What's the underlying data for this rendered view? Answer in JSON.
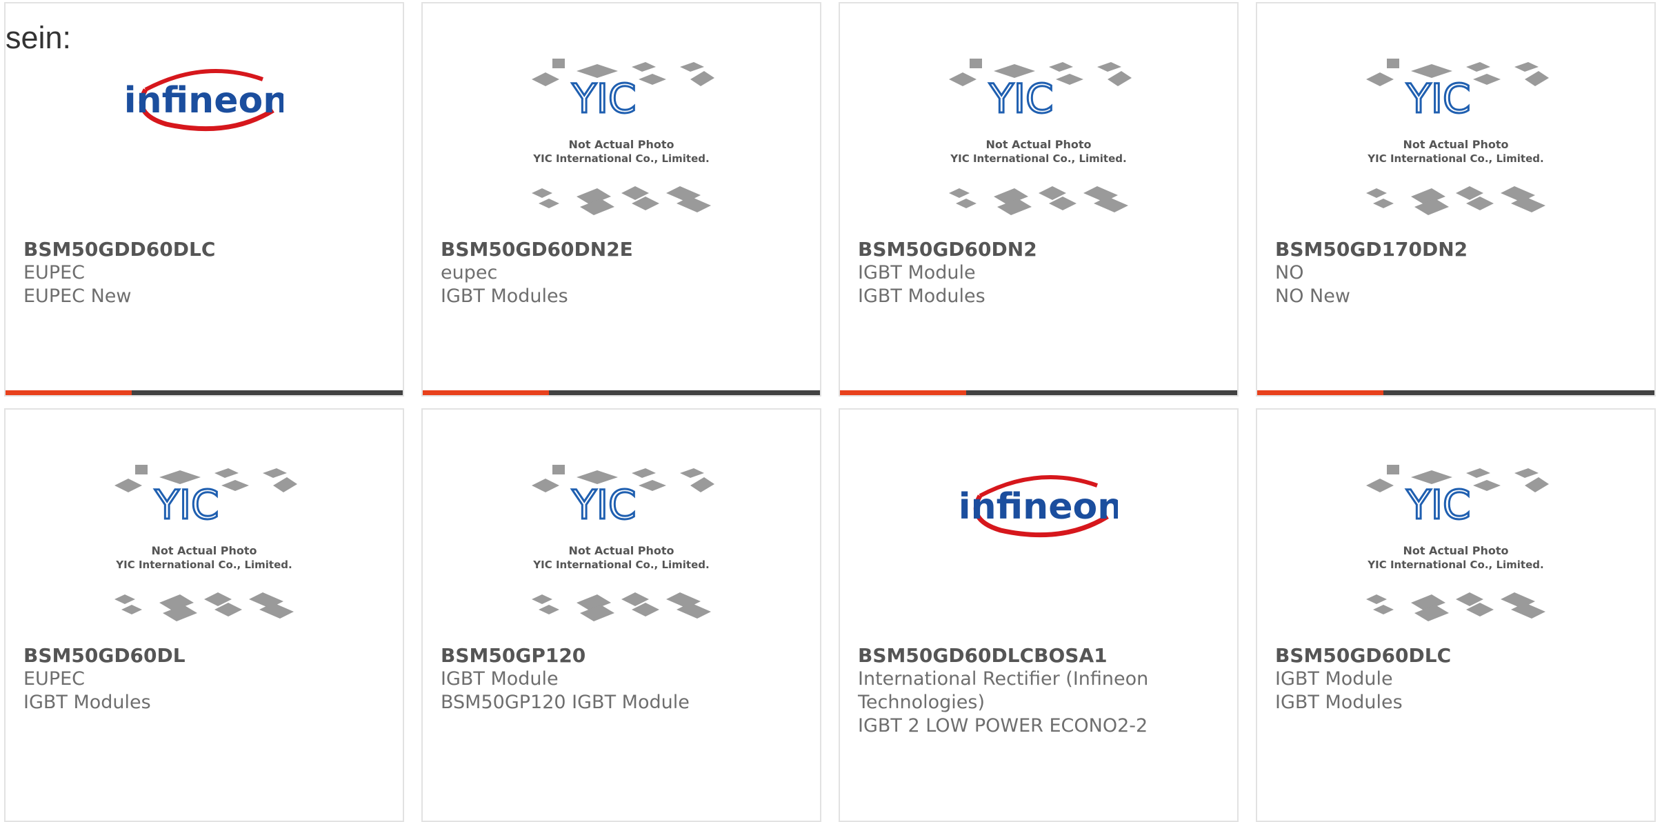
{
  "intro_text": "sein:",
  "colors": {
    "accent": "#e8411c",
    "bar": "#424242",
    "border": "#e2e2e2",
    "yic_blue": "#1f5fb0",
    "infineon_blue": "#1b4e9e",
    "infineon_red": "#d6171c"
  },
  "placeholder": {
    "line1": "Not Actual Photo",
    "line2": "YIC International Co., Limited.",
    "logo": "YIC"
  },
  "infineon_logo_text": "infineon",
  "products": [
    {
      "part": "BSM50GDD60DLC",
      "manufacturer": "EUPEC",
      "description": "EUPEC New",
      "image": "infineon-logo"
    },
    {
      "part": "BSM50GD60DN2E",
      "manufacturer": "eupec",
      "description": "IGBT Modules",
      "image": "yic-placeholder"
    },
    {
      "part": "BSM50GD60DN2",
      "manufacturer": "IGBT Module",
      "description": "IGBT Modules",
      "image": "yic-placeholder"
    },
    {
      "part": "BSM50GD170DN2",
      "manufacturer": "NO",
      "description": "NO New",
      "image": "yic-placeholder"
    },
    {
      "part": "BSM50GD60DL",
      "manufacturer": "EUPEC",
      "description": "IGBT Modules",
      "image": "yic-placeholder"
    },
    {
      "part": "BSM50GP120",
      "manufacturer": "IGBT Module",
      "description": "BSM50GP120 IGBT Module",
      "image": "yic-placeholder"
    },
    {
      "part": "BSM50GD60DLCBOSA1",
      "manufacturer": "International Rectifier (Infineon Technologies)",
      "description": "IGBT 2 LOW POWER ECONO2-2",
      "image": "infineon-logo"
    },
    {
      "part": "BSM50GD60DLC",
      "manufacturer": "IGBT Module",
      "description": "IGBT Modules",
      "image": "yic-placeholder"
    }
  ]
}
